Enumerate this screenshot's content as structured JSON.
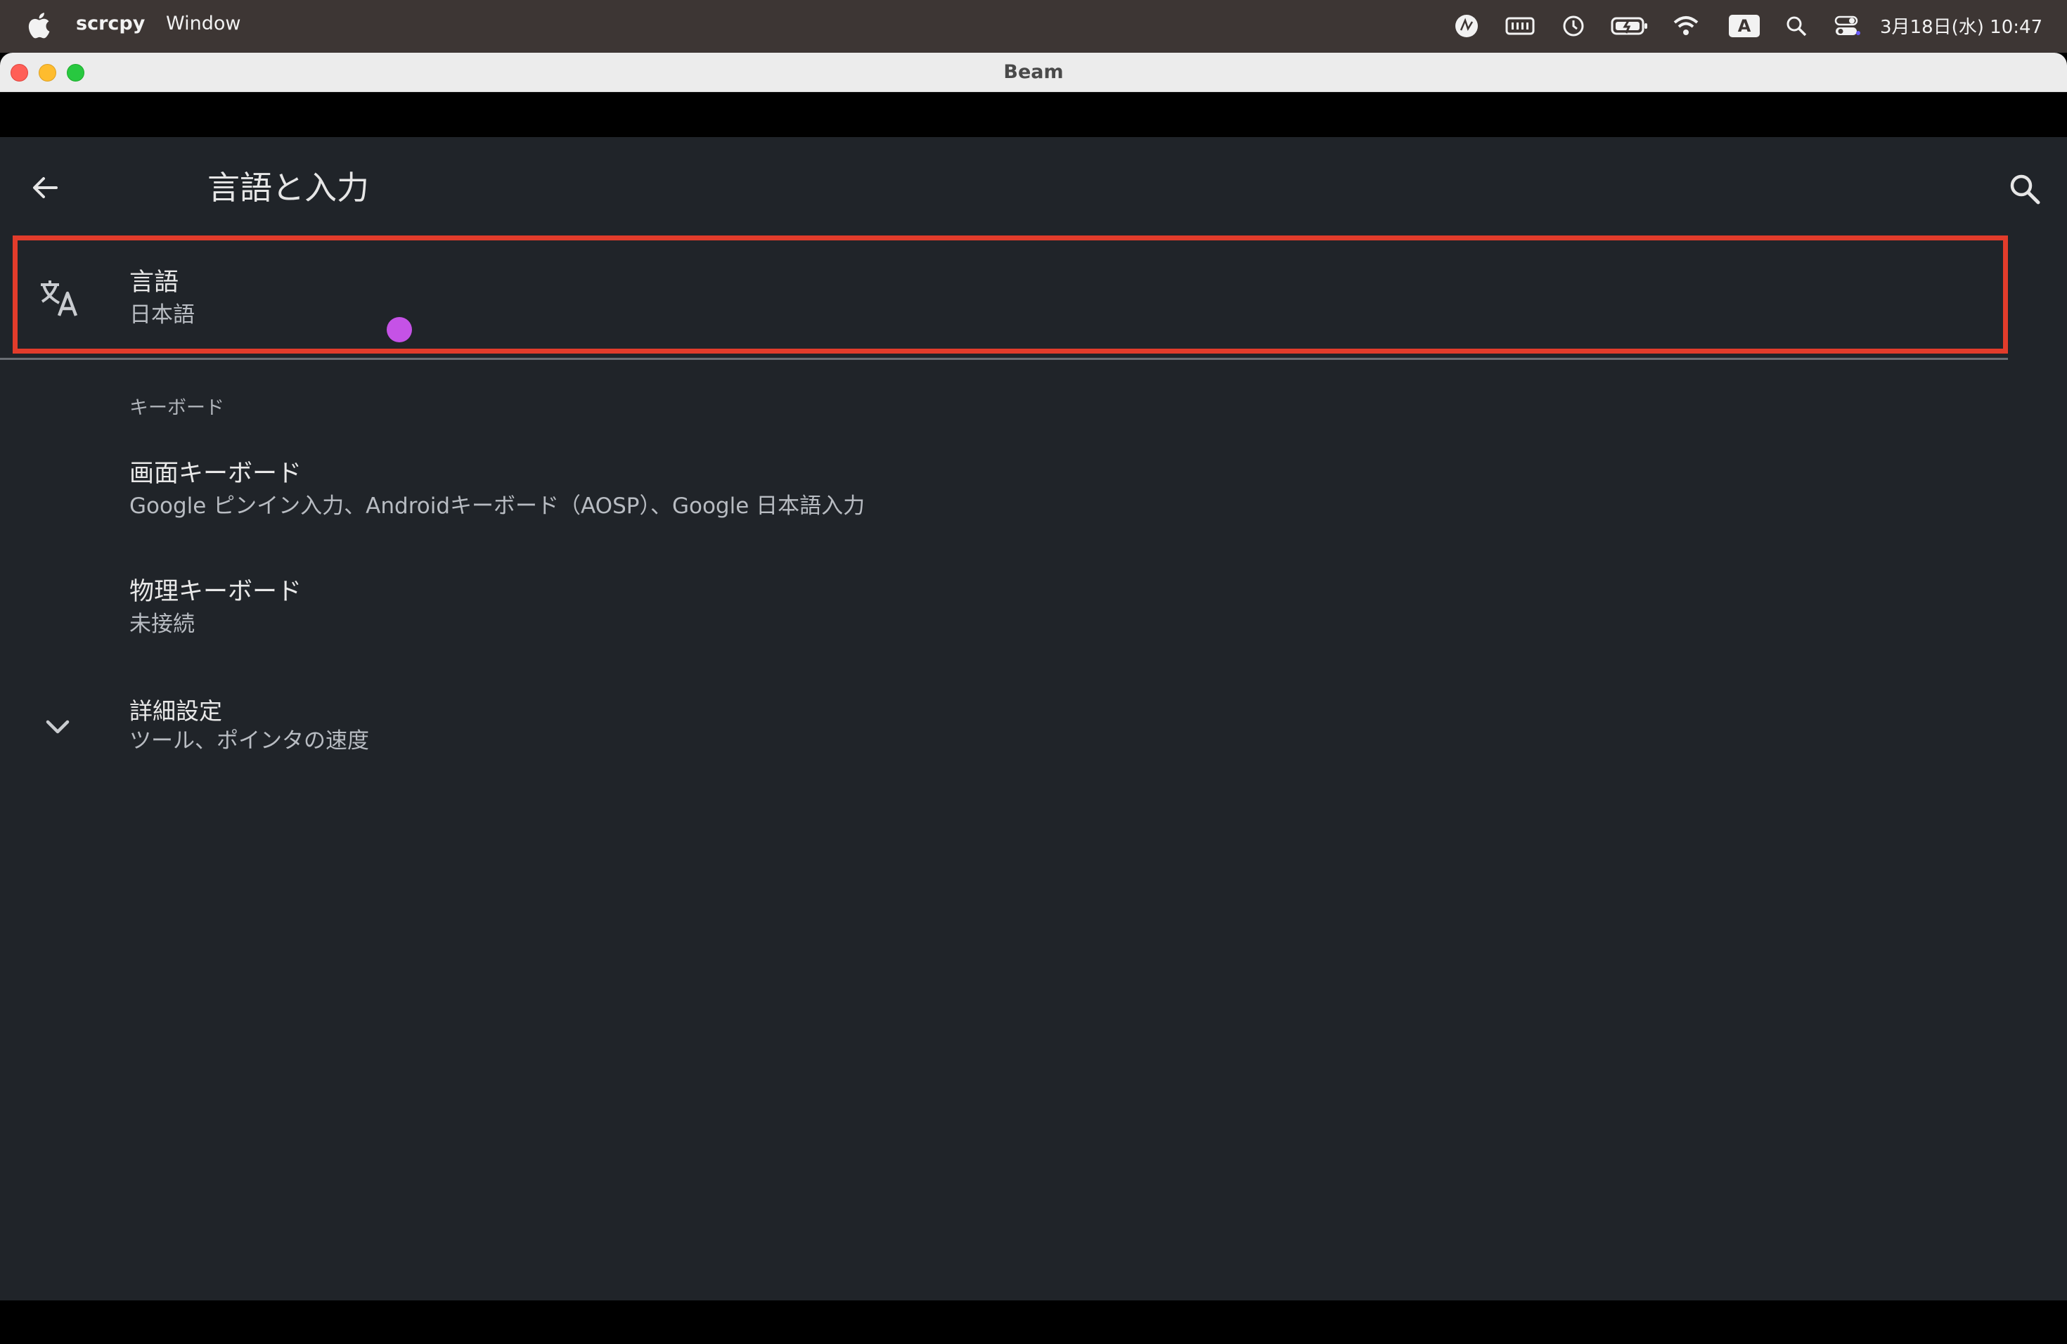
{
  "menubar": {
    "app_name": "scrcpy",
    "menu_window": "Window",
    "input_indicator": "A",
    "clock": "3月18日(水) 10:47",
    "tray_icons": [
      "accessibility-icon",
      "keyboard-icon",
      "time-machine-icon",
      "battery-icon",
      "wifi-icon",
      "input-source-icon",
      "spotlight-icon",
      "control-center-icon"
    ]
  },
  "window": {
    "title": "Beam"
  },
  "screen": {
    "appbar_title": "言語と入力",
    "language_item": {
      "title": "言語",
      "summary": "日本語"
    },
    "keyboard_section": {
      "header": "キーボード",
      "items": [
        {
          "title": "画面キーボード",
          "summary": "Google ピンイン入力、Androidキーボード（AOSP）、Google 日本語入力"
        },
        {
          "title": "物理キーボード",
          "summary": "未接続"
        }
      ]
    },
    "advanced_item": {
      "title": "詳細設定",
      "summary": "ツール、ポインタの速度"
    }
  },
  "colors": {
    "screen_bg": "#202429",
    "highlight_border": "#e23c2b",
    "touch_indicator": "#c552e6",
    "menubar_bg": "#3d3634"
  }
}
